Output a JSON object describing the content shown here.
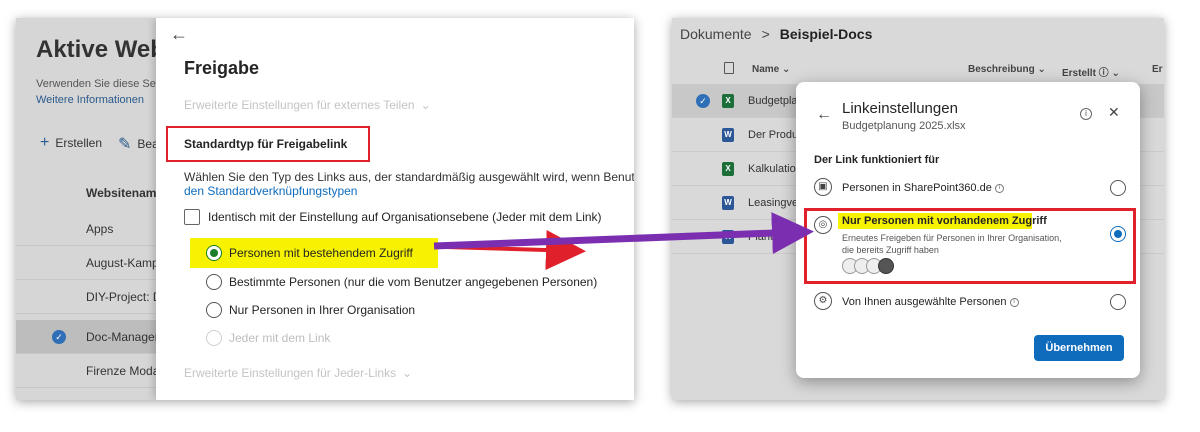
{
  "left_screen": {
    "admin": {
      "page_title": "Aktive Web",
      "description": "Verwenden Sie diese Se",
      "more_link": "Weitere Informationen ",
      "create_label": "Erstellen",
      "edit_label": "Bea",
      "column_header": "Websitename",
      "rows": [
        "Apps",
        "August-Kamp",
        "DIY-Project: D",
        "Doc-Manager",
        "Firenze Moda"
      ]
    },
    "panel": {
      "title": "Freigabe",
      "external_settings": "Erweiterte Einstellungen für externes Teilen",
      "section_heading": "Standardtyp für Freigabelink",
      "help_text": "Wählen Sie den Typ des Links aus, der standardmäßig ausgewählt wird, wenn Benutzer",
      "help_link": "den Standardverknüpfungstypen",
      "checkbox_label": "Identisch mit der Einstellung auf Organisationsebene (Jeder mit dem Link)",
      "options": [
        "Personen mit bestehendem Zugriff",
        "Bestimmte Personen (nur die vom Benutzer angegebenen Personen)",
        "Nur Personen in Ihrer Organisation",
        "Jeder mit dem Link"
      ],
      "anyone_settings": "Erweiterte Einstellungen für Jeder-Links"
    }
  },
  "right_screen": {
    "breadcrumb": {
      "root": "Dokumente",
      "separator": ">",
      "current": "Beispiel-Docs"
    },
    "columns": {
      "name": "Name",
      "description": "Beschreibung",
      "created": "Erstellt",
      "extra": "Er"
    },
    "files": [
      "Budgetpla",
      "Der Produ",
      "Kalkulatio",
      "Leasingve",
      "Planung"
    ],
    "dialog": {
      "title": "Linkeinstellungen",
      "subtitle": "Budgetplanung 2025.xlsx",
      "group_label": "Der Link funktioniert für",
      "options": [
        {
          "label": "Personen in SharePoint360.de",
          "description": ""
        },
        {
          "label": "Nur Personen mit vorhandenem Zugriff",
          "description": "Erneutes Freigeben für Personen in Ihrer Organisation, die bereits Zugriff haben"
        },
        {
          "label": "Von Ihnen ausgewählte Personen",
          "description": ""
        }
      ],
      "apply_button": "Übernehmen"
    }
  },
  "colors": {
    "highlight_yellow": "#f7f200",
    "annotation_red": "#e0202a",
    "arrow_purple": "#7b2fb0",
    "accent_blue": "#0f6cbd",
    "radio_green": "#1b7c2a"
  }
}
